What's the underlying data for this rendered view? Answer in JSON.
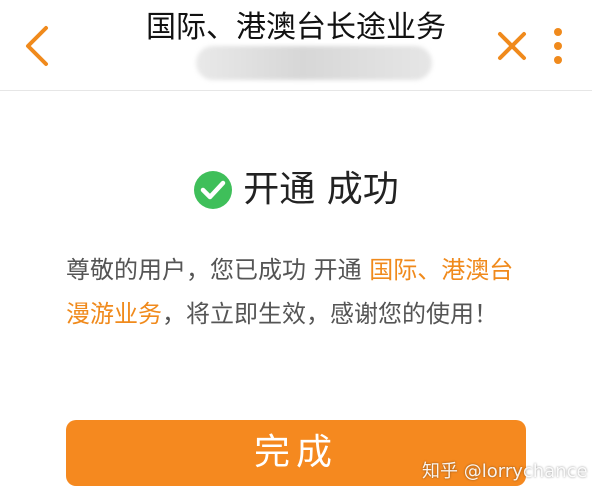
{
  "header": {
    "title": "国际、港澳台长途业务",
    "back_icon": "chevron-left-icon",
    "close_icon": "close-icon",
    "more_icon": "more-vertical-icon"
  },
  "result": {
    "status_icon": "check-circle-icon",
    "status_text": "开通 成功",
    "message_prefix": "尊敬的用户，您已成功 开通 ",
    "message_highlight": "国际、港澳台漫游业务",
    "message_suffix": "，将立即生效，感谢您的使用！"
  },
  "actions": {
    "done_label": "完成"
  },
  "watermark": {
    "text": "知乎 @lorrychance"
  },
  "colors": {
    "accent": "#f5891f",
    "highlight_text": "#f08a1c",
    "success_green": "#3fbf5a",
    "icon_orange": "#f08a1c"
  }
}
